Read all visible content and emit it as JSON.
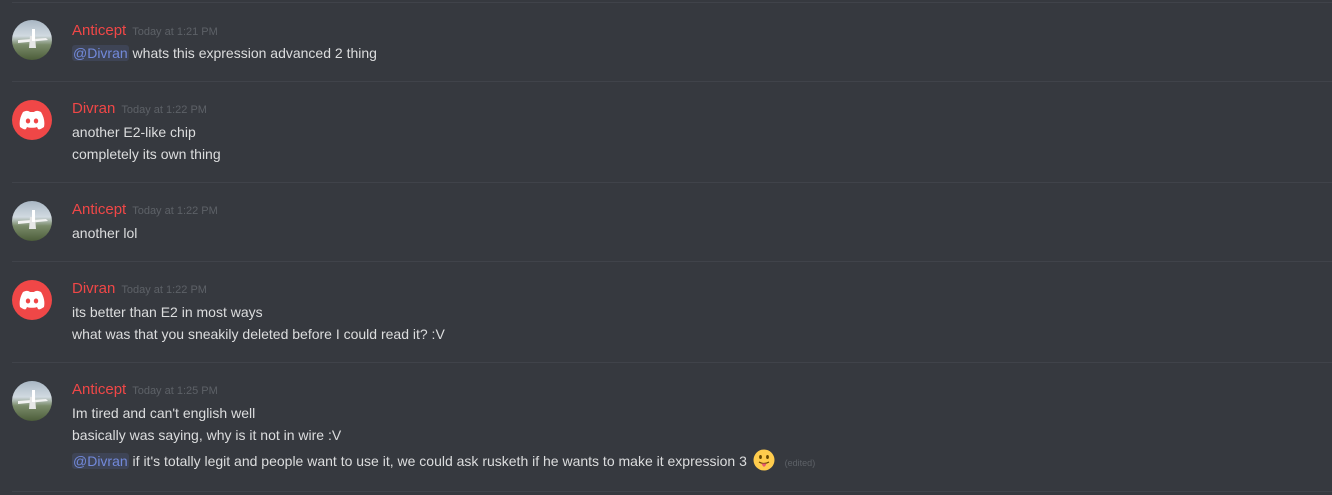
{
  "messages": [
    {
      "author": "Anticept",
      "time": "Today at 1:21 PM",
      "avatar": "photo-avatar",
      "lines": [
        {
          "mention": "@Divran",
          "text": " whats this expression advanced 2 thing"
        }
      ]
    },
    {
      "author": "Divran",
      "time": "Today at 1:22 PM",
      "avatar": "discord-logo-avatar",
      "lines": [
        {
          "text": "another E2-like chip"
        },
        {
          "text": "completely its own thing"
        }
      ]
    },
    {
      "author": "Anticept",
      "time": "Today at 1:22 PM",
      "avatar": "photo-avatar",
      "lines": [
        {
          "text": "another lol"
        }
      ]
    },
    {
      "author": "Divran",
      "time": "Today at 1:22 PM",
      "avatar": "discord-logo-avatar",
      "lines": [
        {
          "text": "its better than E2 in most ways"
        },
        {
          "text": "what was that you sneakily deleted before I could read it? :V"
        }
      ]
    },
    {
      "author": "Anticept",
      "time": "Today at 1:25 PM",
      "avatar": "photo-avatar",
      "lines": [
        {
          "text": "Im tired and can't english well"
        },
        {
          "text": "basically was saying, why is it not in wire :V"
        },
        {
          "mention": "@Divran",
          "text": " if it's totally legit and people want to use it, we could ask rusketh if he wants to make it expression 3",
          "emoji": "tongue-out-emoji",
          "edited": "(edited)"
        }
      ]
    }
  ],
  "colors": {
    "background": "#36393f",
    "username": "#f04747",
    "timestamp": "#5d6167",
    "text": "#dcddde",
    "mention": "#7289da",
    "divider": "#40434a"
  }
}
